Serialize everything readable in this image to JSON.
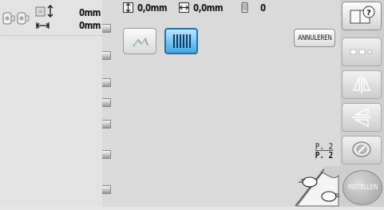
{
  "status": {
    "height_value": "0mm",
    "width_value": "0mm"
  },
  "top_bar": {
    "offset_vertical": "0,0mm",
    "offset_horizontal": "0,0mm",
    "thread_count": "0"
  },
  "main": {
    "cancel_label": "ANNULEREN",
    "page_current": "P. 2",
    "page_total": "P. 2"
  },
  "toolbar": {
    "set_label": "INSTELLEN"
  },
  "colors": {
    "active_button": "#43a8e0",
    "panel_bg": "#e3e3e3",
    "main_bg": "#dadada"
  }
}
